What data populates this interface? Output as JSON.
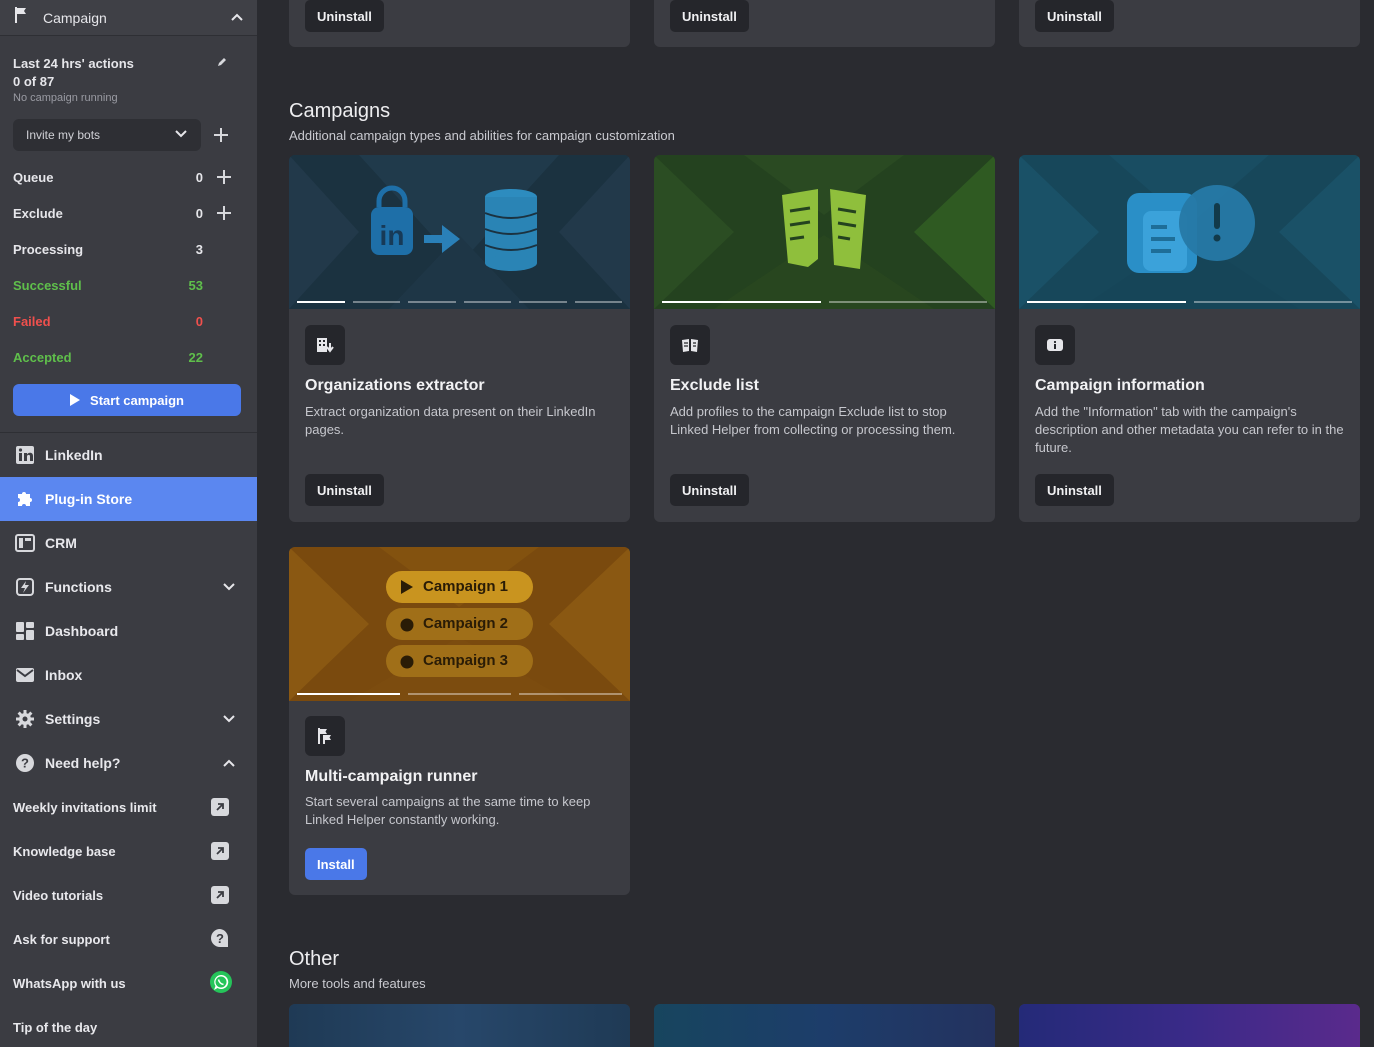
{
  "sidebar": {
    "header": {
      "label": "Campaign"
    },
    "stats": {
      "title": "Last 24 hrs' actions",
      "count": "0 of 87",
      "status": "No campaign running"
    },
    "select": {
      "value": "Invite my bots"
    },
    "queue": [
      {
        "label": "Queue",
        "value": "0"
      },
      {
        "label": "Exclude",
        "value": "0"
      },
      {
        "label": "Processing",
        "value": "3"
      },
      {
        "label": "Successful",
        "value": "53"
      },
      {
        "label": "Failed",
        "value": "0"
      },
      {
        "label": "Accepted",
        "value": "22"
      }
    ],
    "start_button": "Start campaign",
    "nav": [
      {
        "label": "LinkedIn",
        "icon": "linkedin-icon"
      },
      {
        "label": "Plug-in Store",
        "icon": "puzzle-icon"
      },
      {
        "label": "CRM",
        "icon": "crm-icon"
      },
      {
        "label": "Functions",
        "icon": "functions-icon"
      },
      {
        "label": "Dashboard",
        "icon": "dashboard-icon"
      },
      {
        "label": "Inbox",
        "icon": "mail-icon"
      },
      {
        "label": "Settings",
        "icon": "gear-icon"
      },
      {
        "label": "Need help?",
        "icon": "question-icon"
      }
    ],
    "help": [
      {
        "label": "Weekly invitations limit",
        "icon": "external-link-icon"
      },
      {
        "label": "Knowledge base",
        "icon": "external-link-icon"
      },
      {
        "label": "Video tutorials",
        "icon": "external-link-icon"
      },
      {
        "label": "Ask for support",
        "icon": "chat-question-icon"
      },
      {
        "label": "WhatsApp with us",
        "icon": "whatsapp-icon"
      },
      {
        "label": "Tip of the day",
        "icon": ""
      }
    ]
  },
  "main": {
    "top_row_buttons": [
      "Uninstall",
      "Uninstall",
      "Uninstall"
    ],
    "campaigns": {
      "title": "Campaigns",
      "subtitle": "Additional campaign types and abilities for campaign customization",
      "cards": [
        {
          "title": "Organizations extractor",
          "description": "Extract organization data present on their LinkedIn pages.",
          "button": "Uninstall",
          "icon": "building-download-icon"
        },
        {
          "title": "Exclude list",
          "description": "Add profiles to the campaign Exclude list to stop Linked Helper from collecting or processing them.",
          "button": "Uninstall",
          "icon": "exclude-list-icon"
        },
        {
          "title": "Campaign information",
          "description": "Add the \"Information\" tab with the campaign's description and other metadata you can refer to in the future.",
          "button": "Uninstall",
          "icon": "info-icon"
        },
        {
          "title": "Multi-campaign runner",
          "description": "Start several campaigns at the same time to keep Linked Helper constantly working.",
          "button": "Install",
          "icon": "multi-flag-icon",
          "hero_labels": [
            "Campaign 1",
            "Campaign 2",
            "Campaign 3"
          ]
        }
      ]
    },
    "other": {
      "title": "Other",
      "subtitle": "More tools and features"
    }
  },
  "colors": {
    "accent": "#4a78e8",
    "active_nav": "#5b87f0",
    "success": "#5fbf4b",
    "failed": "#f0504d"
  }
}
